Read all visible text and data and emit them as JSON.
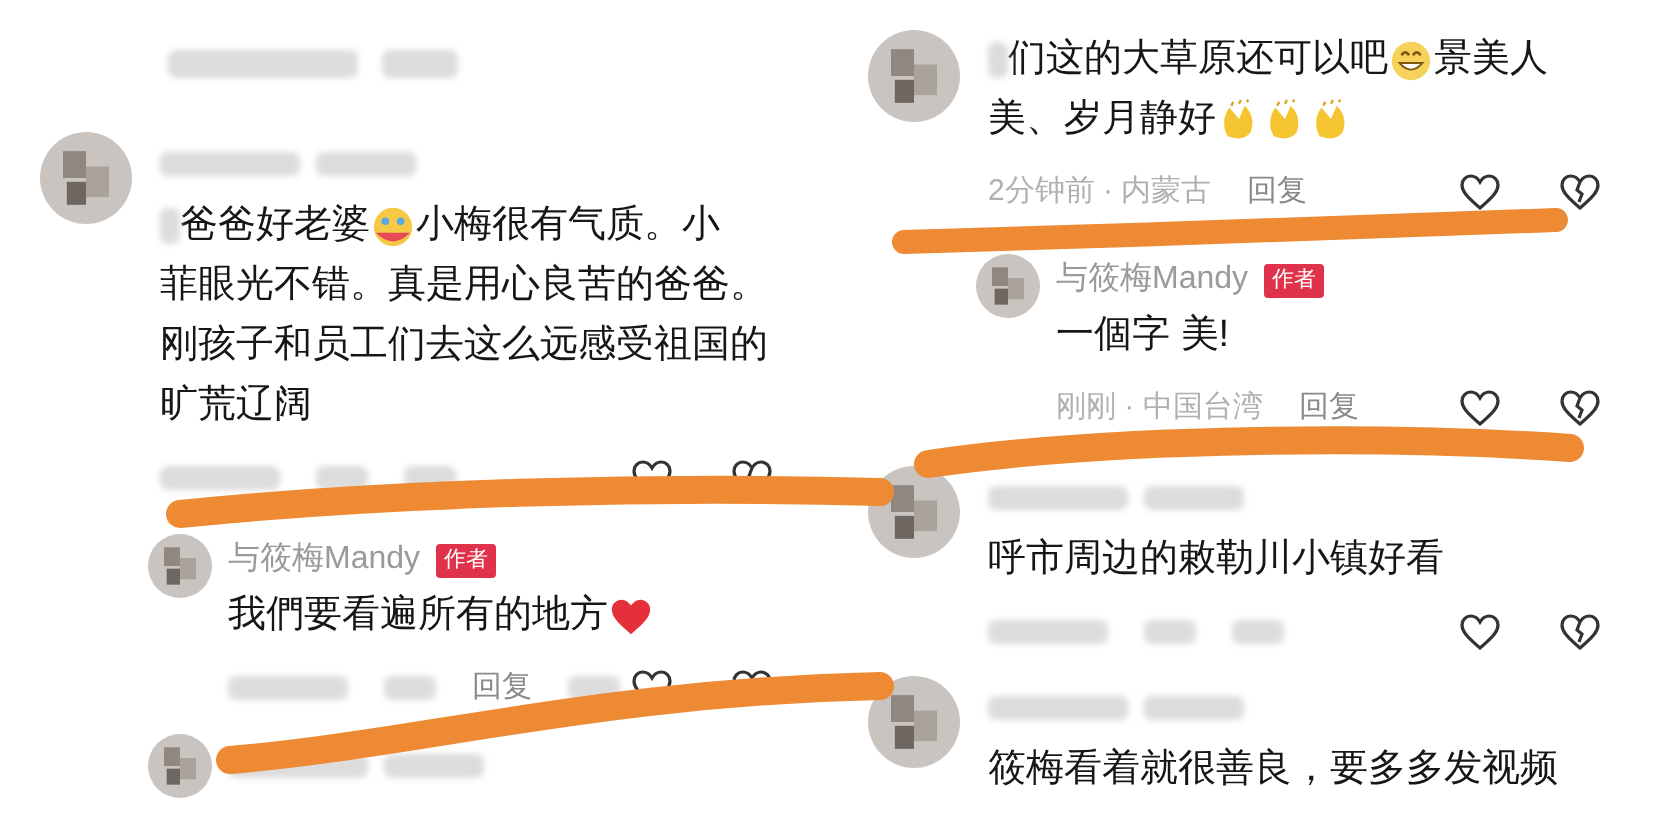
{
  "left_panel": {
    "top_row_blurred": true,
    "comments": [
      {
        "kind": "comment",
        "name_blurred": true,
        "lines": [
          [
            {
              "kind": "blur"
            },
            {
              "kind": "text",
              "text": "爸爸好老婆"
            },
            {
              "kind": "emoji_face"
            },
            {
              "kind": "text",
              "text": "小梅很有气质。小"
            }
          ],
          [
            {
              "kind": "text",
              "text": "菲眼光不错。真是用心良苦的爸爸。"
            }
          ],
          [
            {
              "kind": "text",
              "text": "刚孩子和员工们去这么远感受祖国的"
            }
          ],
          [
            {
              "kind": "text",
              "text": "旷荒辽阔"
            }
          ]
        ],
        "meta": {
          "blurred": true
        }
      },
      {
        "kind": "reply",
        "name": "与筱梅Mandy",
        "badge": "作者",
        "lines": [
          [
            {
              "kind": "text",
              "text": "我們要看遍所有的地方"
            },
            {
              "kind": "emoji_heart"
            }
          ]
        ],
        "meta": {
          "blurred": true,
          "reply": "回复"
        }
      },
      {
        "kind": "reply",
        "name_blurred": true
      }
    ]
  },
  "right_panel": {
    "comments": [
      {
        "kind": "comment",
        "lines": [
          [
            {
              "kind": "blur"
            },
            {
              "kind": "text",
              "text": "们这的大草原还可以吧"
            },
            {
              "kind": "emoji_grin"
            },
            {
              "kind": "text",
              "text": "景美人"
            }
          ],
          [
            {
              "kind": "text",
              "text": "美、岁月静好"
            },
            {
              "kind": "emoji_clap"
            },
            {
              "kind": "emoji_clap"
            },
            {
              "kind": "emoji_clap"
            }
          ]
        ],
        "meta": {
          "time": "2分钟前 · 内蒙古",
          "reply": "回复"
        }
      },
      {
        "kind": "reply",
        "name": "与筱梅Mandy",
        "badge": "作者",
        "lines": [
          [
            {
              "kind": "text",
              "text": "一個字 美!"
            }
          ]
        ],
        "meta": {
          "time": "刚刚 · 中国台湾",
          "reply": "回复"
        }
      },
      {
        "kind": "comment",
        "name_blurred": true,
        "lines": [
          [
            {
              "kind": "text",
              "text": "呼市周边的敕勒川小镇好看"
            }
          ]
        ],
        "meta": {
          "blurred": true
        }
      },
      {
        "kind": "comment",
        "name_blurred": true,
        "lines": [
          [
            {
              "kind": "text",
              "text": "筱梅看着就很善良，要多多发视频"
            }
          ]
        ]
      }
    ]
  }
}
